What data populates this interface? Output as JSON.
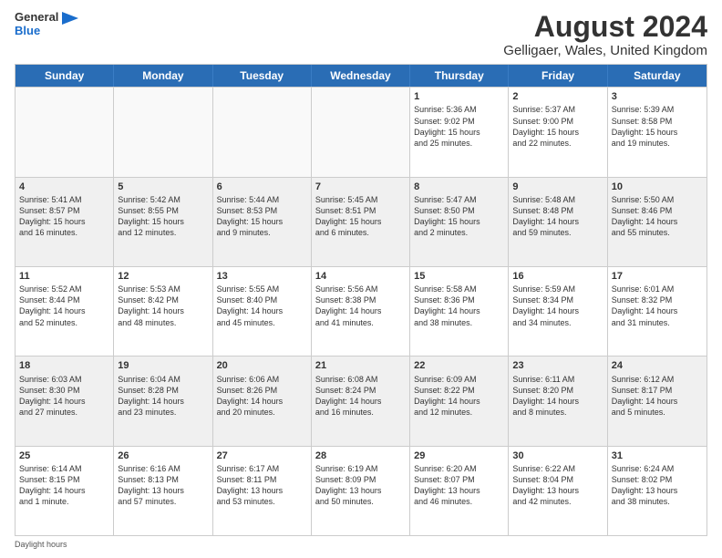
{
  "header": {
    "logo_general": "General",
    "logo_blue": "Blue",
    "main_title": "August 2024",
    "subtitle": "Gelligaer, Wales, United Kingdom"
  },
  "calendar": {
    "days": [
      "Sunday",
      "Monday",
      "Tuesday",
      "Wednesday",
      "Thursday",
      "Friday",
      "Saturday"
    ],
    "weeks": [
      [
        {
          "day": "",
          "text": ""
        },
        {
          "day": "",
          "text": ""
        },
        {
          "day": "",
          "text": ""
        },
        {
          "day": "",
          "text": ""
        },
        {
          "day": "1",
          "text": "Sunrise: 5:36 AM\nSunset: 9:02 PM\nDaylight: 15 hours\nand 25 minutes."
        },
        {
          "day": "2",
          "text": "Sunrise: 5:37 AM\nSunset: 9:00 PM\nDaylight: 15 hours\nand 22 minutes."
        },
        {
          "day": "3",
          "text": "Sunrise: 5:39 AM\nSunset: 8:58 PM\nDaylight: 15 hours\nand 19 minutes."
        }
      ],
      [
        {
          "day": "4",
          "text": "Sunrise: 5:41 AM\nSunset: 8:57 PM\nDaylight: 15 hours\nand 16 minutes."
        },
        {
          "day": "5",
          "text": "Sunrise: 5:42 AM\nSunset: 8:55 PM\nDaylight: 15 hours\nand 12 minutes."
        },
        {
          "day": "6",
          "text": "Sunrise: 5:44 AM\nSunset: 8:53 PM\nDaylight: 15 hours\nand 9 minutes."
        },
        {
          "day": "7",
          "text": "Sunrise: 5:45 AM\nSunset: 8:51 PM\nDaylight: 15 hours\nand 6 minutes."
        },
        {
          "day": "8",
          "text": "Sunrise: 5:47 AM\nSunset: 8:50 PM\nDaylight: 15 hours\nand 2 minutes."
        },
        {
          "day": "9",
          "text": "Sunrise: 5:48 AM\nSunset: 8:48 PM\nDaylight: 14 hours\nand 59 minutes."
        },
        {
          "day": "10",
          "text": "Sunrise: 5:50 AM\nSunset: 8:46 PM\nDaylight: 14 hours\nand 55 minutes."
        }
      ],
      [
        {
          "day": "11",
          "text": "Sunrise: 5:52 AM\nSunset: 8:44 PM\nDaylight: 14 hours\nand 52 minutes."
        },
        {
          "day": "12",
          "text": "Sunrise: 5:53 AM\nSunset: 8:42 PM\nDaylight: 14 hours\nand 48 minutes."
        },
        {
          "day": "13",
          "text": "Sunrise: 5:55 AM\nSunset: 8:40 PM\nDaylight: 14 hours\nand 45 minutes."
        },
        {
          "day": "14",
          "text": "Sunrise: 5:56 AM\nSunset: 8:38 PM\nDaylight: 14 hours\nand 41 minutes."
        },
        {
          "day": "15",
          "text": "Sunrise: 5:58 AM\nSunset: 8:36 PM\nDaylight: 14 hours\nand 38 minutes."
        },
        {
          "day": "16",
          "text": "Sunrise: 5:59 AM\nSunset: 8:34 PM\nDaylight: 14 hours\nand 34 minutes."
        },
        {
          "day": "17",
          "text": "Sunrise: 6:01 AM\nSunset: 8:32 PM\nDaylight: 14 hours\nand 31 minutes."
        }
      ],
      [
        {
          "day": "18",
          "text": "Sunrise: 6:03 AM\nSunset: 8:30 PM\nDaylight: 14 hours\nand 27 minutes."
        },
        {
          "day": "19",
          "text": "Sunrise: 6:04 AM\nSunset: 8:28 PM\nDaylight: 14 hours\nand 23 minutes."
        },
        {
          "day": "20",
          "text": "Sunrise: 6:06 AM\nSunset: 8:26 PM\nDaylight: 14 hours\nand 20 minutes."
        },
        {
          "day": "21",
          "text": "Sunrise: 6:08 AM\nSunset: 8:24 PM\nDaylight: 14 hours\nand 16 minutes."
        },
        {
          "day": "22",
          "text": "Sunrise: 6:09 AM\nSunset: 8:22 PM\nDaylight: 14 hours\nand 12 minutes."
        },
        {
          "day": "23",
          "text": "Sunrise: 6:11 AM\nSunset: 8:20 PM\nDaylight: 14 hours\nand 8 minutes."
        },
        {
          "day": "24",
          "text": "Sunrise: 6:12 AM\nSunset: 8:17 PM\nDaylight: 14 hours\nand 5 minutes."
        }
      ],
      [
        {
          "day": "25",
          "text": "Sunrise: 6:14 AM\nSunset: 8:15 PM\nDaylight: 14 hours\nand 1 minute."
        },
        {
          "day": "26",
          "text": "Sunrise: 6:16 AM\nSunset: 8:13 PM\nDaylight: 13 hours\nand 57 minutes."
        },
        {
          "day": "27",
          "text": "Sunrise: 6:17 AM\nSunset: 8:11 PM\nDaylight: 13 hours\nand 53 minutes."
        },
        {
          "day": "28",
          "text": "Sunrise: 6:19 AM\nSunset: 8:09 PM\nDaylight: 13 hours\nand 50 minutes."
        },
        {
          "day": "29",
          "text": "Sunrise: 6:20 AM\nSunset: 8:07 PM\nDaylight: 13 hours\nand 46 minutes."
        },
        {
          "day": "30",
          "text": "Sunrise: 6:22 AM\nSunset: 8:04 PM\nDaylight: 13 hours\nand 42 minutes."
        },
        {
          "day": "31",
          "text": "Sunrise: 6:24 AM\nSunset: 8:02 PM\nDaylight: 13 hours\nand 38 minutes."
        }
      ]
    ]
  },
  "footer": {
    "text": "Daylight hours"
  }
}
